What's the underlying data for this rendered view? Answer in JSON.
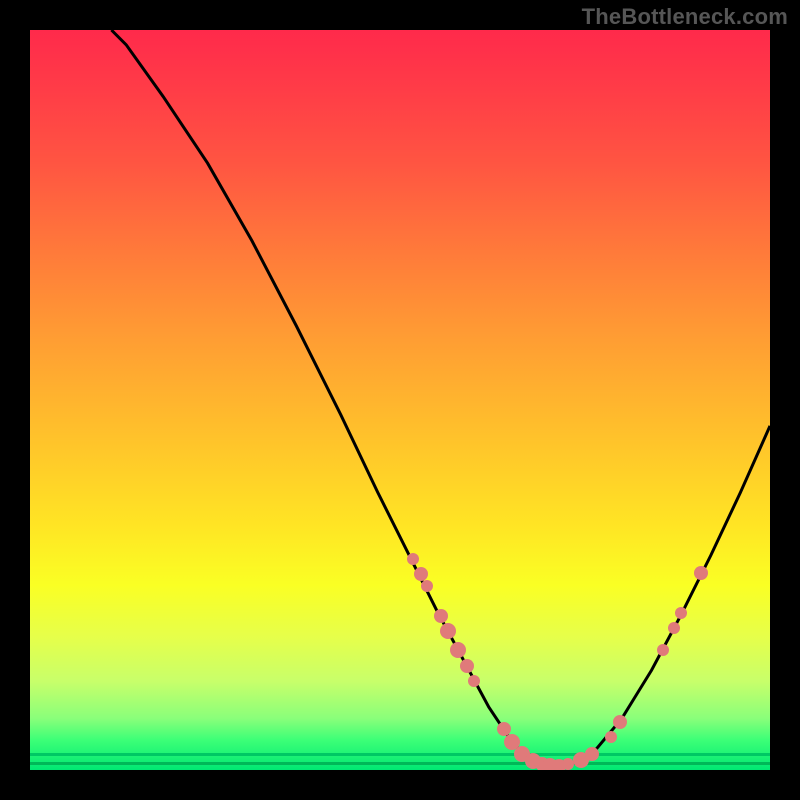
{
  "watermark": "TheBottleneck.com",
  "colors": {
    "background": "#000000",
    "curve_stroke": "#000000",
    "marker_fill": "#e07a7a",
    "gradient_top": "#ff2a4b",
    "gradient_bottom": "#00e873"
  },
  "chart_data": {
    "type": "line",
    "title": "",
    "xlabel": "",
    "ylabel": "",
    "x_range": [
      0,
      100
    ],
    "y_range": [
      0,
      100
    ],
    "note": "Axes unlabeled. Values are estimated positions in percent of plot box (0 = top/left, 100 = bottom/right for both axes as read from pixel space). Curve dips to bottom around x≈67-74 then rises.",
    "series": [
      {
        "name": "curve",
        "points": [
          {
            "x": 11.0,
            "y": 0.0
          },
          {
            "x": 13.0,
            "y": 2.0
          },
          {
            "x": 18.0,
            "y": 9.0
          },
          {
            "x": 24.0,
            "y": 18.0
          },
          {
            "x": 30.0,
            "y": 28.5
          },
          {
            "x": 36.0,
            "y": 40.0
          },
          {
            "x": 42.0,
            "y": 52.0
          },
          {
            "x": 47.0,
            "y": 62.5
          },
          {
            "x": 51.0,
            "y": 70.5
          },
          {
            "x": 55.0,
            "y": 78.5
          },
          {
            "x": 58.5,
            "y": 85.0
          },
          {
            "x": 62.0,
            "y": 91.5
          },
          {
            "x": 65.0,
            "y": 96.0
          },
          {
            "x": 67.0,
            "y": 98.3
          },
          {
            "x": 70.0,
            "y": 99.4
          },
          {
            "x": 73.5,
            "y": 99.0
          },
          {
            "x": 76.0,
            "y": 97.8
          },
          {
            "x": 80.0,
            "y": 93.0
          },
          {
            "x": 84.0,
            "y": 86.5
          },
          {
            "x": 88.0,
            "y": 79.0
          },
          {
            "x": 92.0,
            "y": 71.0
          },
          {
            "x": 96.0,
            "y": 62.5
          },
          {
            "x": 100.0,
            "y": 53.5
          }
        ]
      },
      {
        "name": "markers",
        "points": [
          {
            "x": 51.8,
            "y": 71.5,
            "size": "small"
          },
          {
            "x": 52.8,
            "y": 73.5,
            "size": "med"
          },
          {
            "x": 53.7,
            "y": 75.2,
            "size": "small"
          },
          {
            "x": 55.5,
            "y": 79.2,
            "size": "med"
          },
          {
            "x": 56.5,
            "y": 81.2,
            "size": "big"
          },
          {
            "x": 57.8,
            "y": 83.8,
            "size": "big"
          },
          {
            "x": 59.0,
            "y": 86.0,
            "size": "med"
          },
          {
            "x": 60.0,
            "y": 88.0,
            "size": "small"
          },
          {
            "x": 64.0,
            "y": 94.5,
            "size": "med"
          },
          {
            "x": 65.2,
            "y": 96.2,
            "size": "big"
          },
          {
            "x": 66.5,
            "y": 97.8,
            "size": "big"
          },
          {
            "x": 68.0,
            "y": 98.8,
            "size": "big"
          },
          {
            "x": 69.2,
            "y": 99.2,
            "size": "med"
          },
          {
            "x": 70.3,
            "y": 99.4,
            "size": "big"
          },
          {
            "x": 71.5,
            "y": 99.4,
            "size": "med"
          },
          {
            "x": 72.7,
            "y": 99.2,
            "size": "small"
          },
          {
            "x": 74.5,
            "y": 98.6,
            "size": "big"
          },
          {
            "x": 76.0,
            "y": 97.8,
            "size": "med"
          },
          {
            "x": 78.5,
            "y": 95.5,
            "size": "small"
          },
          {
            "x": 79.7,
            "y": 93.5,
            "size": "med"
          },
          {
            "x": 85.5,
            "y": 83.8,
            "size": "small"
          },
          {
            "x": 87.0,
            "y": 80.8,
            "size": "small"
          },
          {
            "x": 88.0,
            "y": 78.8,
            "size": "small"
          },
          {
            "x": 90.7,
            "y": 73.4,
            "size": "med"
          }
        ]
      }
    ]
  }
}
